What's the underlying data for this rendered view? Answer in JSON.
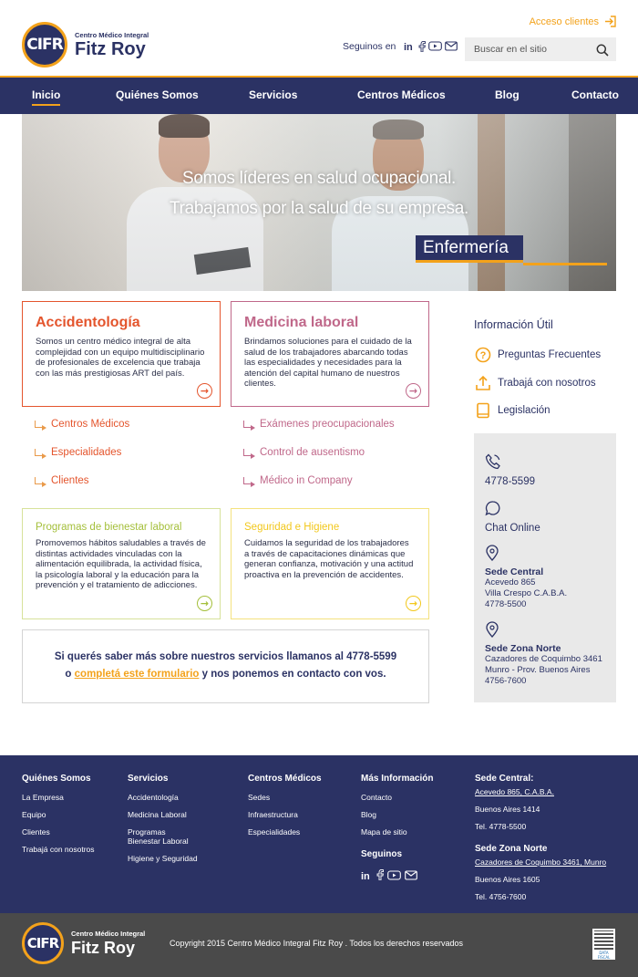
{
  "brand": {
    "logo_text": "CIFR",
    "subtitle": "Centro Médico Integral",
    "name": "Fitz Roy",
    "accent": "#f3a21b",
    "navy": "#2b3264"
  },
  "header": {
    "acceso_label": "Acceso clientes",
    "seguinos_label": "Seguinos en",
    "social": [
      "linkedin-icon",
      "facebook-icon",
      "youtube-icon",
      "mail-icon"
    ],
    "search_placeholder": "Buscar en el sitio"
  },
  "nav": {
    "items": [
      {
        "label": "Inicio",
        "active": true
      },
      {
        "label": "Quiénes Somos"
      },
      {
        "label": "Servicios"
      },
      {
        "label": "Centros Médicos"
      },
      {
        "label": "Blog"
      },
      {
        "label": "Contacto"
      }
    ]
  },
  "hero": {
    "line1": "Somos líderes en salud ocupacional.",
    "line2": "Trabajamos por la salud de su empresa.",
    "tag": "Enfermería"
  },
  "cards": {
    "accidentologia": {
      "title": "Accidentología",
      "text": "Somos un centro médico integral de alta complejidad con un equipo multidisciplinario de profesionales de excelencia que trabaja con las más prestigiosas ART del país.",
      "color": "#e4552d"
    },
    "medicina": {
      "title": "Medicina laboral",
      "text": "Brindamos soluciones para el cuidado de la salud de los trabajadores abarcando todas las especialidades y necesidades para la atención del capital humano de nuestros clientes.",
      "color": "#c0688a"
    },
    "bienestar": {
      "title": "Programas de bienestar laboral",
      "text": "Promovemos hábitos saludables a través de distintas actividades vinculadas con la alimentación equilibrada, la actividad física, la psicología laboral y la educación para la prevención y el tratamiento de adicciones.",
      "color": "#a4bf3a"
    },
    "seguridad": {
      "title": "Seguridad e Higiene",
      "text": "Cuidamos la seguridad de los trabajadores a través de capacitaciones dinámicas que generan confianza, motivación y una actitud proactiva en la prevención de accidentes.",
      "color": "#f2c81d"
    }
  },
  "links_left": [
    "Centros Médicos",
    "Especialidades",
    "Clientes"
  ],
  "links_right": [
    "Exámenes preocupacionales",
    "Control de ausentismo",
    "Médico in Company"
  ],
  "cta": {
    "line1": "Si querés saber más sobre nuestros servicios llamanos al 4778-5599",
    "line2_pre": "o",
    "line2_link": "completá este formulario",
    "line2_post": "y nos ponemos en contacto con vos."
  },
  "sidebar": {
    "title": "Información Útil",
    "items": [
      {
        "label": "Preguntas Frecuentes",
        "icon": "question-icon"
      },
      {
        "label": "Trabajá con nosotros",
        "icon": "upload-icon"
      },
      {
        "label": "Legislación",
        "icon": "book-icon"
      }
    ],
    "phone": "4778-5599",
    "chat": "Chat Online",
    "sede_central": {
      "title": "Sede Central",
      "lines": [
        "Acevedo 865",
        "Villa Crespo C.A.B.A.",
        "4778-5500"
      ]
    },
    "sede_norte": {
      "title": "Sede Zona Norte",
      "lines": [
        "Cazadores de Coquimbo 3461",
        "Munro - Prov. Buenos Aires",
        "4756-7600"
      ]
    }
  },
  "footer": {
    "cols": [
      {
        "title": "Quiénes Somos",
        "links": [
          "La Empresa",
          "Equipo",
          "Clientes",
          "Trabajá con nosotros"
        ]
      },
      {
        "title": "Servicios",
        "links": [
          "Accidentología",
          "Medicina Laboral",
          "Programas\nBienestar Laboral",
          "Higiene y Seguridad"
        ]
      },
      {
        "title": "Centros Médicos",
        "links": [
          "Sedes",
          "Infraestructura",
          "Especialidades"
        ]
      },
      {
        "title": "Más Información",
        "links": [
          "Contacto",
          "Blog",
          "Mapa de sitio"
        ]
      }
    ],
    "seguinos": "Seguinos",
    "sede_central": {
      "title": "Sede Central:",
      "link": "Acevedo 865, C.A.B.A.",
      "lines": [
        "Buenos Aires 1414",
        "Tel. 4778-5500"
      ]
    },
    "sede_norte": {
      "title": "Sede Zona Norte",
      "link": "Cazadores de Coquimbo 3461, Munro",
      "lines": [
        "Buenos Aires 1605",
        "Tel. 4756-7600"
      ]
    },
    "copyright": "Copyright 2015 Centro Médico Integral Fitz Roy . Todos los derechos reservados",
    "qr_label": "DATA FISCAL"
  }
}
